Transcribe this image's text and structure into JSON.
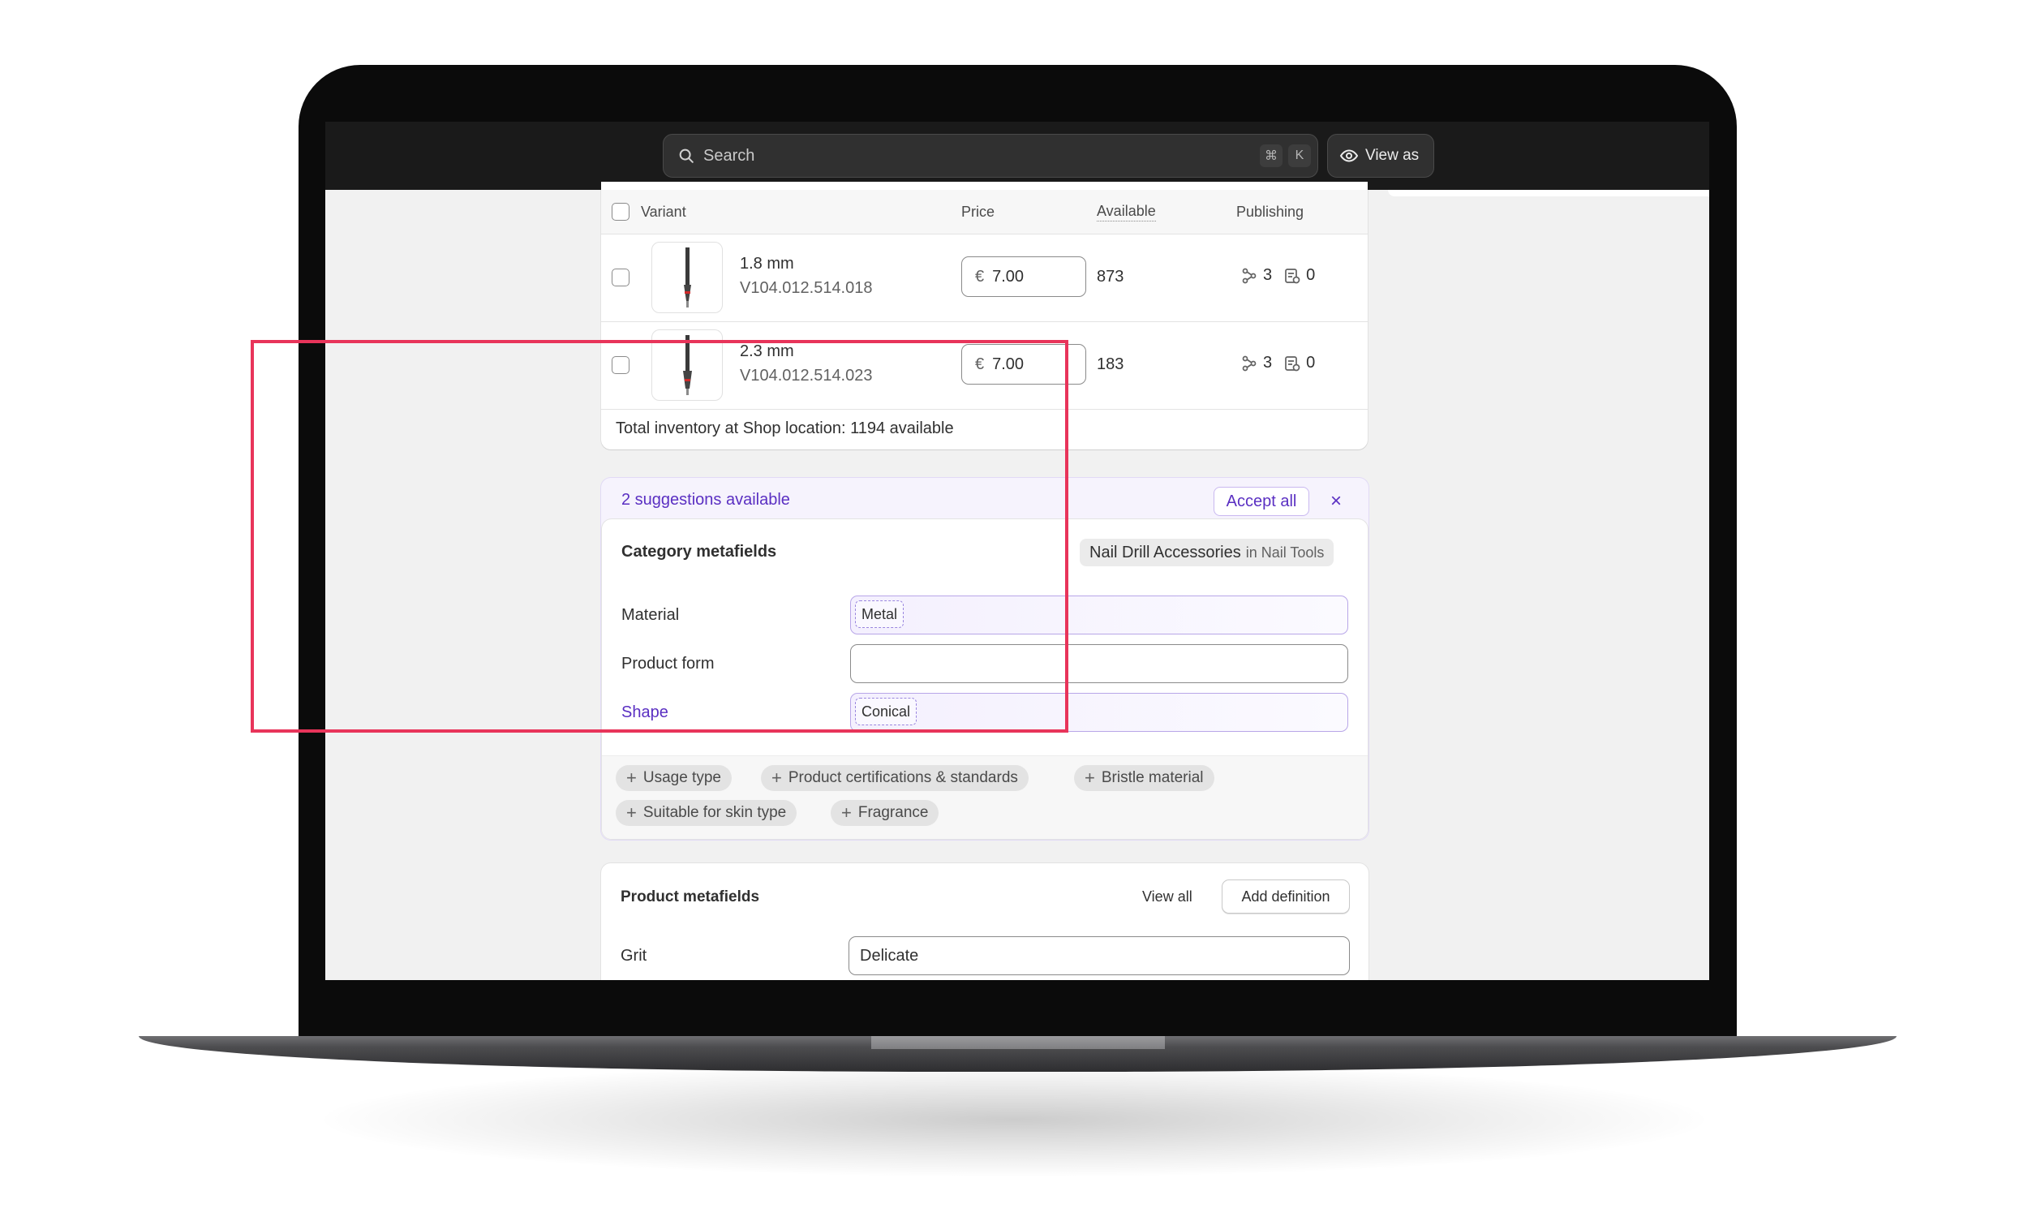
{
  "search": {
    "placeholder": "Search",
    "shortcut_cmd": "⌘",
    "shortcut_key": "K"
  },
  "view_as": {
    "label": "View as"
  },
  "variants_table": {
    "headers": {
      "variant": "Variant",
      "price": "Price",
      "available": "Available",
      "publishing": "Publishing"
    },
    "rows": [
      {
        "name": "1.8 mm",
        "sku": "V104.012.514.018",
        "currency": "€",
        "price": "7.00",
        "available": "873",
        "channels": "3",
        "catalogs": "0"
      },
      {
        "name": "2.3 mm",
        "sku": "V104.012.514.023",
        "currency": "€",
        "price": "7.00",
        "available": "183",
        "channels": "3",
        "catalogs": "0"
      }
    ],
    "total_inventory": "Total inventory at Shop location: 1194 available"
  },
  "suggestions": {
    "title": "2 suggestions available",
    "accept_all": "Accept all",
    "close": "×",
    "section_title": "Category metafields",
    "category_name": "Nail Drill Accessories",
    "category_sub": "in Nail Tools",
    "fields": [
      {
        "label": "Material",
        "value": "Metal"
      },
      {
        "label": "Product form",
        "value": ""
      },
      {
        "label": "Shape",
        "value": "Conical"
      }
    ],
    "chips": [
      "Usage type",
      "Product certifications & standards",
      "Bristle material",
      "Suitable for skin type",
      "Fragrance"
    ]
  },
  "product_metafields": {
    "title": "Product metafields",
    "view_all": "View all",
    "add_definition": "Add definition",
    "fields": [
      {
        "label": "Grit",
        "value": "Delicate"
      }
    ]
  },
  "colors": {
    "accent_purple": "#5a2fc2",
    "highlight_border": "#e8345a",
    "topbar": "#1a1a1a"
  }
}
